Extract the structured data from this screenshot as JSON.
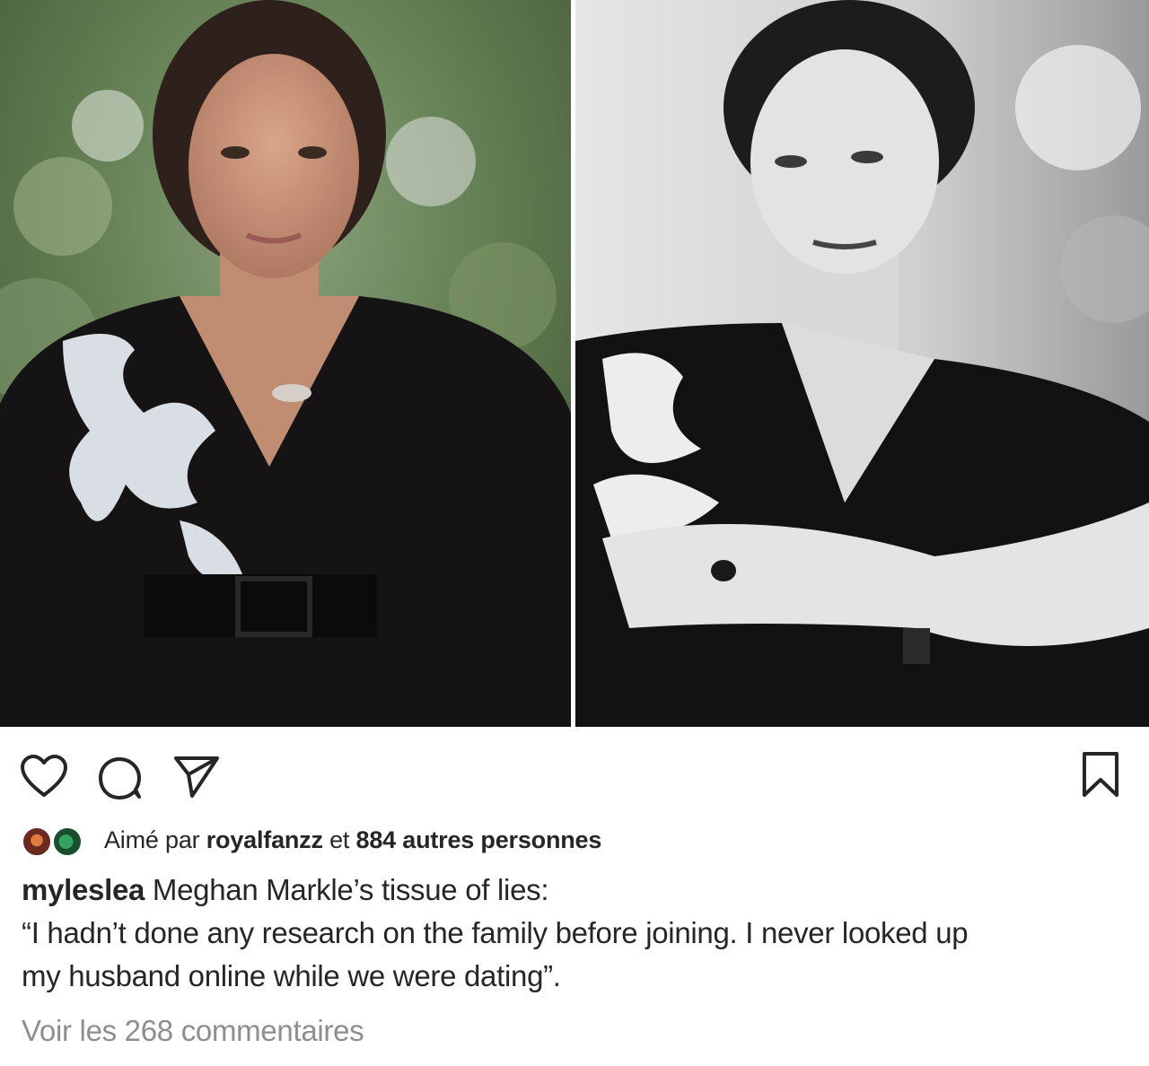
{
  "post": {
    "images": [
      {
        "name": "left-photo",
        "style": "color"
      },
      {
        "name": "right-photo",
        "style": "black-and-white"
      }
    ],
    "actions": {
      "like_icon": "heart-outline-icon",
      "comment_icon": "comment-bubble-icon",
      "share_icon": "paper-plane-icon",
      "save_icon": "bookmark-icon"
    },
    "likes": {
      "prefix": "Aimé par ",
      "liked_by_user": "royalfanzz",
      "middle": " et ",
      "others": "884 autres personnes"
    },
    "caption": {
      "username": "myleslea",
      "first_line": " Meghan Markle’s tissue of lies:",
      "line2": "“I hadn’t done any research on the family before joining. I never looked up",
      "line3": "my husband online while we were dating”."
    },
    "view_comments": "Voir les 268 commentaires"
  },
  "colors": {
    "text": "#262626",
    "muted": "#8e8e8e",
    "background": "#ffffff"
  }
}
